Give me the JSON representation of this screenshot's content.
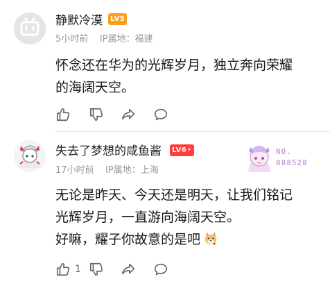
{
  "comments": [
    {
      "username": "静默冷漠",
      "level": "LV5",
      "time": "5小时前",
      "ip": "IP属地：福建",
      "lines": [
        "怀念还在华为的光辉岁月，独立奔向荣耀",
        "的海阔天空。"
      ],
      "like_count": ""
    },
    {
      "username": "失去了梦想的咸鱼酱",
      "level": "LV6",
      "time": "17小时前",
      "ip": "IP属地：上海",
      "lines": [
        "无论是昨天、今天还是明天，让我们铭记",
        "光辉岁月，一直游向海阔天空。",
        "好嘛，耀子你故意的是吧"
      ],
      "like_count": "1",
      "badge": {
        "label": "NO.",
        "number": "088520"
      }
    }
  ],
  "icons": [
    "like-icon",
    "dislike-icon",
    "share-icon",
    "reply-icon"
  ],
  "colors": {
    "lv5": "#ff9e1b",
    "lv6": "#ff3d3d",
    "meta": "#9499a0",
    "icon": "#61666d"
  }
}
